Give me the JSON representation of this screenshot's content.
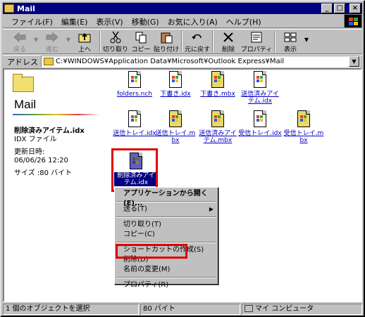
{
  "window": {
    "title": "Mail",
    "minimize": "_",
    "maximize": "□",
    "close": "×"
  },
  "menubar": [
    "ファイル(F)",
    "編集(E)",
    "表示(V)",
    "移動(G)",
    "お気に入り(A)",
    "ヘルプ(H)"
  ],
  "toolbar": {
    "back": "戻る",
    "forward": "進む",
    "up": "上へ",
    "cut": "切り取り",
    "copy": "コピー",
    "paste": "貼り付け",
    "undo": "元に戻す",
    "delete": "削除",
    "properties": "プロパティ",
    "view": "表示"
  },
  "address": {
    "label": "アドレス",
    "path": "C:¥WINDOWS¥Application Data¥Microsoft¥Outlook Express¥Mail"
  },
  "sidepanel": {
    "folder_title": "Mail",
    "file_name": "削除済みアイテム.idx",
    "file_type": "IDX ファイル",
    "modified_label": "更新日時:",
    "modified_value": "06/06/26 12:20",
    "size": "サイズ :80 バイト"
  },
  "files": {
    "f1": "folders.nch",
    "f2": "下書き.idx",
    "f3": "下書き.mbx",
    "f4": "送信済みアイテム.idx",
    "f5": "送信トレイ.idx",
    "f6": "送信トレイ.mbx",
    "f7": "送信済みアイテム.mbx",
    "f8": "受信トレイ.idx",
    "f9": "受信トレイ.mbx",
    "f10": "削除済みアイテム.idx"
  },
  "context_menu": {
    "open_with": "アプリケーションから開く(E)...",
    "send_to": "送る(T)",
    "cut": "切り取り(T)",
    "copy": "コピー(C)",
    "shortcut": "ショートカットの作成(S)",
    "delete": "削除(D)",
    "rename": "名前の変更(M)",
    "properties": "プロパティ(R)"
  },
  "statusbar": {
    "selection": "1 個のオブジェクトを選択",
    "size": "80 バイト",
    "location": "マイ コンピュータ"
  },
  "colors": {
    "titlebar": "#000080",
    "highlight_box": "#e00000",
    "selection": "#000080"
  }
}
